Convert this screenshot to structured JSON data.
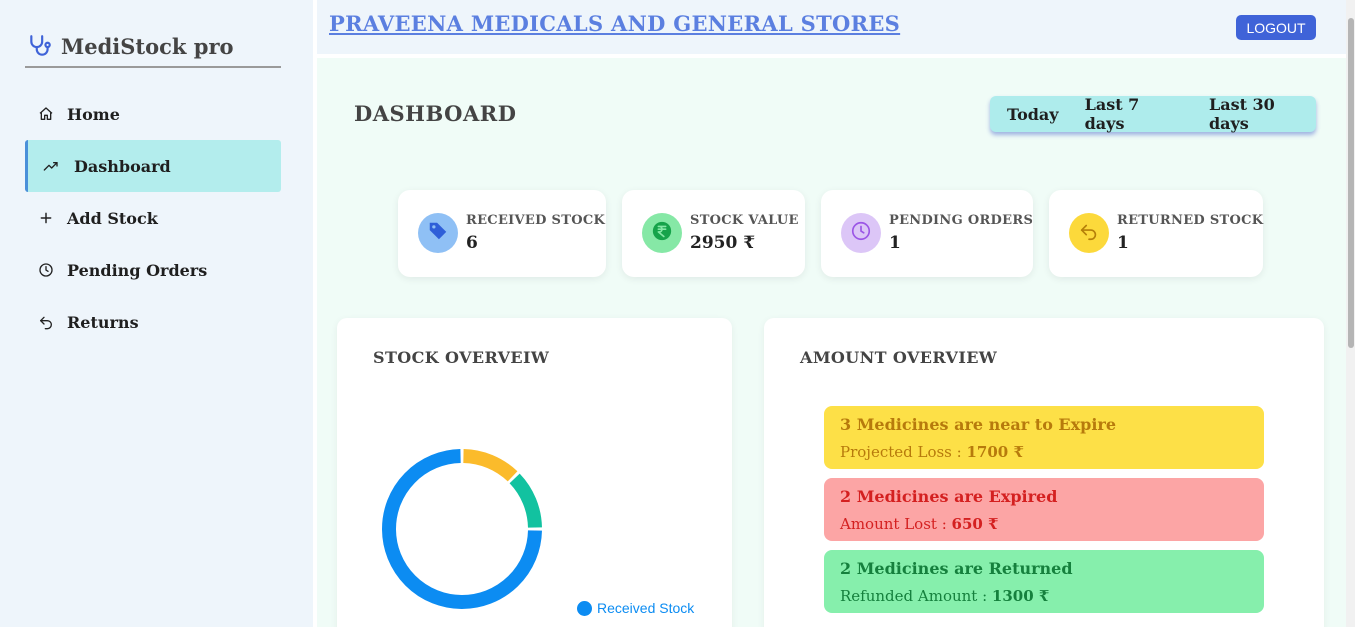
{
  "app": {
    "name": "MediStock pro",
    "logo_icon": "stethoscope-icon"
  },
  "sidebar": {
    "items": [
      {
        "label": "Home",
        "icon": "home-icon",
        "active": false
      },
      {
        "label": "Dashboard",
        "icon": "trending-up-icon",
        "active": true
      },
      {
        "label": "Add Stock",
        "icon": "plus-icon",
        "active": false
      },
      {
        "label": "Pending Orders",
        "icon": "clock-icon",
        "active": false
      },
      {
        "label": "Returns",
        "icon": "undo-icon",
        "active": false
      }
    ]
  },
  "header": {
    "store_name": "PRAVEENA MEDICALS AND GENERAL STORES",
    "logout_label": "LOGOUT"
  },
  "dashboard": {
    "title": "DASHBOARD",
    "ranges": [
      "Today",
      "Last 7 days",
      "Last 30 days"
    ]
  },
  "stats": [
    {
      "label": "RECEIVED STOCK",
      "value": "6",
      "icon": "tag-icon",
      "color": "#8fc0f5",
      "icon_color": "#2f5fd8"
    },
    {
      "label": "STOCK VALUE",
      "value": "2950 ₹",
      "icon": "rupee-icon",
      "color": "#86e8a6",
      "icon_color": "#16a34a"
    },
    {
      "label": "PENDING ORDERS",
      "value": "1",
      "icon": "clock-icon",
      "color": "#dcc6f7",
      "icon_color": "#9b55e6"
    },
    {
      "label": "RETURNED STOCK",
      "value": "1",
      "icon": "return-icon",
      "color": "#fcd93b",
      "icon_color": "#b57f09"
    }
  ],
  "stock_overview": {
    "title": "STOCK OVERVEIW",
    "legend": [
      {
        "label": "Received Stock",
        "color": "#0c8cf2"
      }
    ]
  },
  "chart_data": {
    "type": "pie",
    "variant": "donut",
    "labels": [
      "Received Stock",
      "",
      ""
    ],
    "values": [
      6,
      1,
      1
    ],
    "colors": [
      "#0c8cf2",
      "#fbbb2b",
      "#12c2a0"
    ],
    "legend": [
      "Received Stock"
    ],
    "legend_position": "bottom-right"
  },
  "amount_overview": {
    "title": "AMOUNT OVERVIEW",
    "alerts": [
      {
        "heading": "3 Medicines are near to Expire",
        "label": "Projected Loss : ",
        "amount": "1700 ₹",
        "bg": "#fde047",
        "heading_color": "#b77a0c",
        "text_color": "#b77a0c"
      },
      {
        "heading": "2 Medicines are Expired",
        "label": "Amount Lost : ",
        "amount": "650 ₹",
        "bg": "#fca5a5",
        "heading_color": "#d42020",
        "text_color": "#d42020"
      },
      {
        "heading": "2 Medicines are Returned",
        "label": "Refunded Amount : ",
        "amount": "1300 ₹",
        "bg": "#86efac",
        "heading_color": "#15803d",
        "text_color": "#15803d"
      }
    ]
  }
}
